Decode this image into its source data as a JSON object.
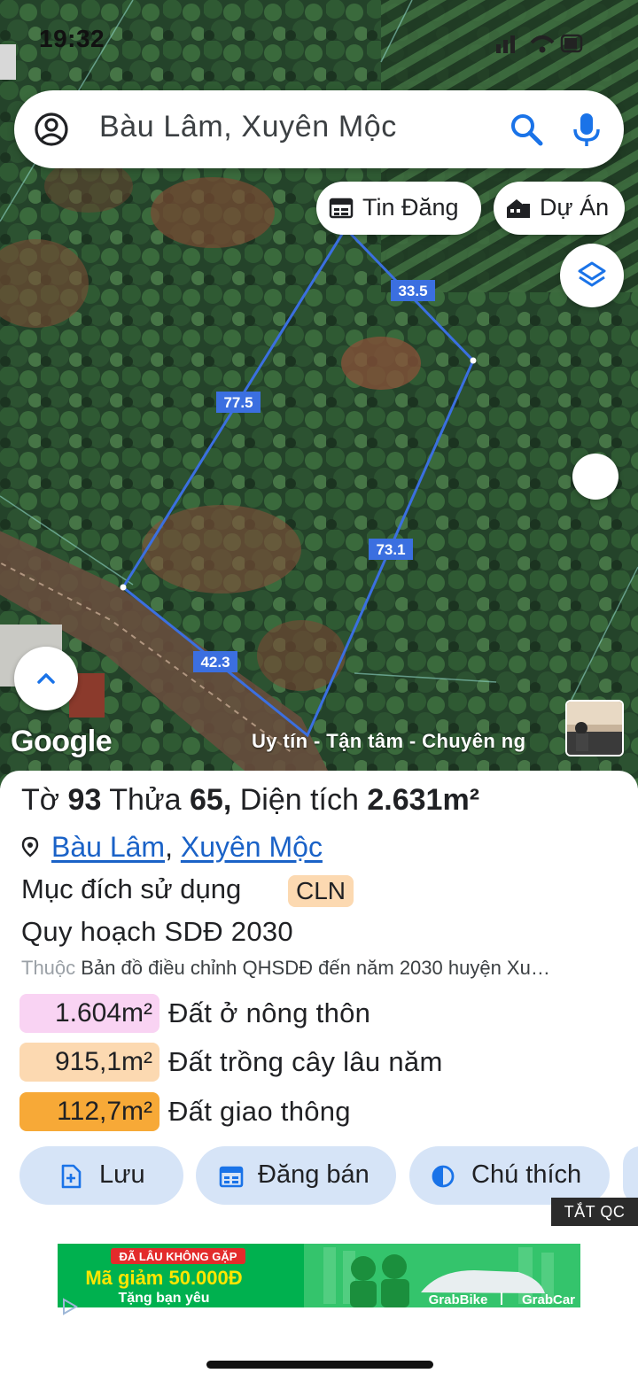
{
  "status_bar": {
    "time": "19:32"
  },
  "search": {
    "value": "Bàu Lâm, Xuyên Mộc"
  },
  "chips": {
    "listing": "Tin Đăng",
    "project": "Dự Án"
  },
  "map": {
    "edge_labels": {
      "north": "33.5",
      "west": "77.5",
      "east": "73.1",
      "south": "42.3"
    },
    "attribution": "Google",
    "ticker": "Uy tín - Tận tâm - Chuyên ng",
    "parcel_outline_color": "#3b6fe0"
  },
  "parcel": {
    "sheet_label": "Tờ",
    "sheet": "93",
    "lot_label": "Thửa",
    "lot": "65,",
    "area_label": "Diện tích",
    "area": "2.631m²",
    "ward": "Bàu Lâm",
    "district": "Xuyên Mộc",
    "separator": ",",
    "use_label": "Mục đích sử dụng",
    "use_code": "CLN",
    "plan_title": "Quy hoạch SDĐ 2030",
    "source_prefix": "Thuộc",
    "source": "Bản đồ điều chỉnh QHSDĐ đến năm 2030 huyện Xu…"
  },
  "zoning": [
    {
      "area": "1.604m²",
      "label": "Đất ở nông thôn",
      "color": "#f9d3f3"
    },
    {
      "area": "915,1m²",
      "label": "Đất trồng cây lâu năm",
      "color": "#fcd9b1"
    },
    {
      "area": "112,7m²",
      "label": "Đất giao thông",
      "color": "#f7a937"
    }
  ],
  "actions": {
    "save": "Lưu",
    "post": "Đăng bán",
    "legend": "Chú thích"
  },
  "ads": {
    "hide_label": "TẮT QC",
    "banner_line1": "ĐÃ LÂU KHÔNG GẶP",
    "banner_line2": "Mã giảm 50.000Đ",
    "banner_line3": "Tặng bạn yêu",
    "banner_brand1": "GrabBike",
    "banner_brand2": "GrabCar"
  }
}
